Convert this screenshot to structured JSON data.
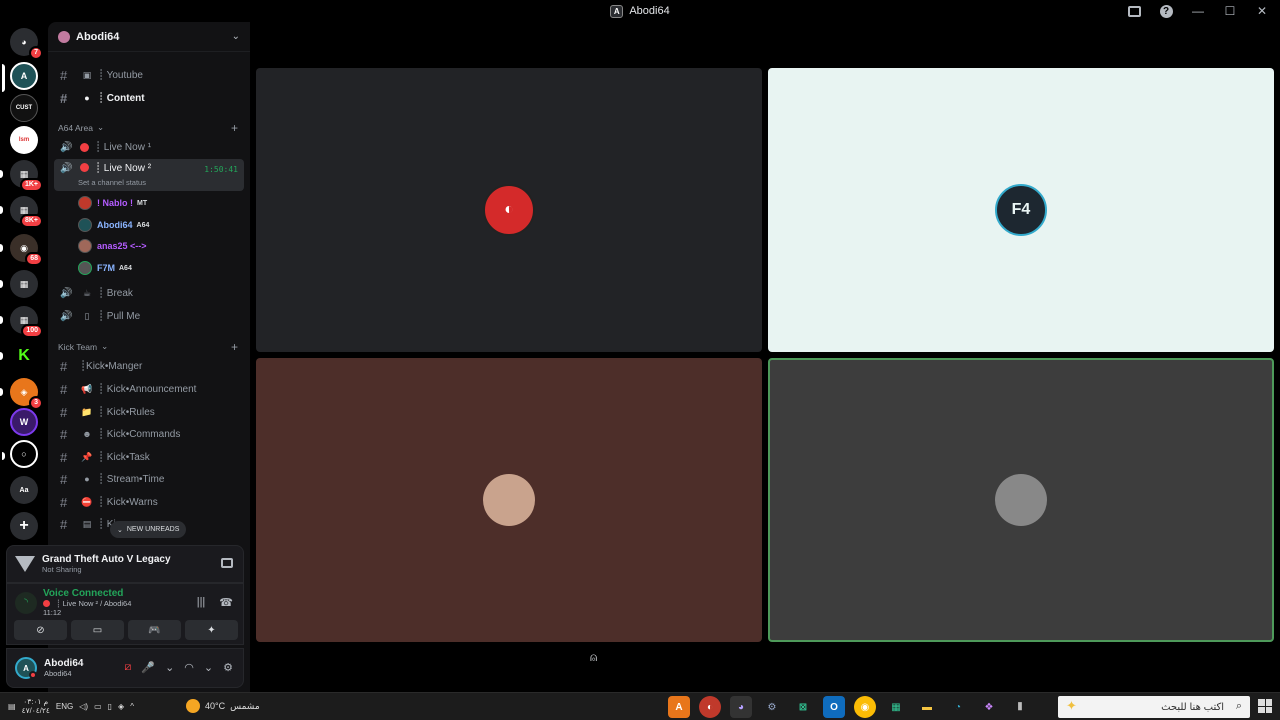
{
  "window": {
    "title": "Abodi64"
  },
  "rail": {
    "servers": [
      {
        "name": "discord-home",
        "badge": "7"
      },
      {
        "name": "abodi64-server",
        "badge": ""
      },
      {
        "name": "customs-server",
        "badge": ""
      },
      {
        "name": "server-orange",
        "badge": ""
      },
      {
        "name": "folder-1",
        "badge": "1K+"
      },
      {
        "name": "folder-2",
        "badge": "8K+"
      },
      {
        "name": "server-dark",
        "badge": "68"
      },
      {
        "name": "folder-3",
        "badge": ""
      },
      {
        "name": "folder-4",
        "badge": "100"
      },
      {
        "name": "kick-server",
        "badge": ""
      },
      {
        "name": "fire-server",
        "badge": "3"
      },
      {
        "name": "purple-server",
        "badge": ""
      },
      {
        "name": "white-server",
        "badge": ""
      },
      {
        "name": "font-server",
        "badge": ""
      }
    ]
  },
  "guild": {
    "name": "Abodi64"
  },
  "channels": {
    "top": [
      {
        "label": "┊ Youtube"
      },
      {
        "label": "┊ Content"
      }
    ],
    "cat_a64": "A64 Area",
    "voice": [
      {
        "label": "┊ Live Now ¹"
      },
      {
        "label": "┊ Live Now ²",
        "timer": "1:50:41",
        "status": "Set a channel status"
      }
    ],
    "voice_users": [
      {
        "name": "! Nablo !",
        "tag": "MT",
        "color": "#b45cff"
      },
      {
        "name": "Abodi64",
        "tag": "A64",
        "color": "#8ab4ff"
      },
      {
        "name": "anas25 <-->",
        "tag": "",
        "color": "#b45cff"
      },
      {
        "name": "F7M",
        "tag": "A64",
        "color": "#8ab4ff"
      }
    ],
    "voice_more": [
      {
        "label": "┊ Break"
      },
      {
        "label": "┊ Pull Me"
      }
    ],
    "cat_kick": "Kick Team",
    "kick": [
      {
        "label": "┊Kick•Manger"
      },
      {
        "label": "┊ Kick•Announcement"
      },
      {
        "label": "┊ Kick•Rules"
      },
      {
        "label": "┊ Kick•Commands"
      },
      {
        "label": "┊ Kick•Task"
      },
      {
        "label": "┊ Stream•Time"
      },
      {
        "label": "┊ Kick•Warns"
      },
      {
        "label": "┊ Ki"
      }
    ],
    "new_unreads": "NEW UNREADS"
  },
  "activity": {
    "game": "Grand Theft Auto V Legacy",
    "game_status": "Not Sharing"
  },
  "voice_panel": {
    "title": "Voice Connected",
    "channel": "┊ Live Now ² / Abodi64",
    "time": "11:12"
  },
  "user": {
    "name": "Abodi64",
    "sub": "Abodi64"
  },
  "stage": {
    "tiles": [
      {
        "name": "tile-1",
        "bg": "#222326"
      },
      {
        "name": "tile-2",
        "bg": "#e8f4f2"
      },
      {
        "name": "tile-3",
        "bg": "#4d2e29"
      },
      {
        "name": "tile-4",
        "bg": "#3d3d3d"
      }
    ]
  },
  "taskbar": {
    "lang": "ENG",
    "time": "م ٠٣:٠١",
    "date": "٤٧/٠٤/٢٤",
    "weather_temp": "40°C",
    "weather_desc": "مشمس",
    "search_placeholder": "اكتب هنا للبحث"
  },
  "colors": {
    "accent_green": "#23a55a",
    "danger_red": "#f23f43"
  }
}
